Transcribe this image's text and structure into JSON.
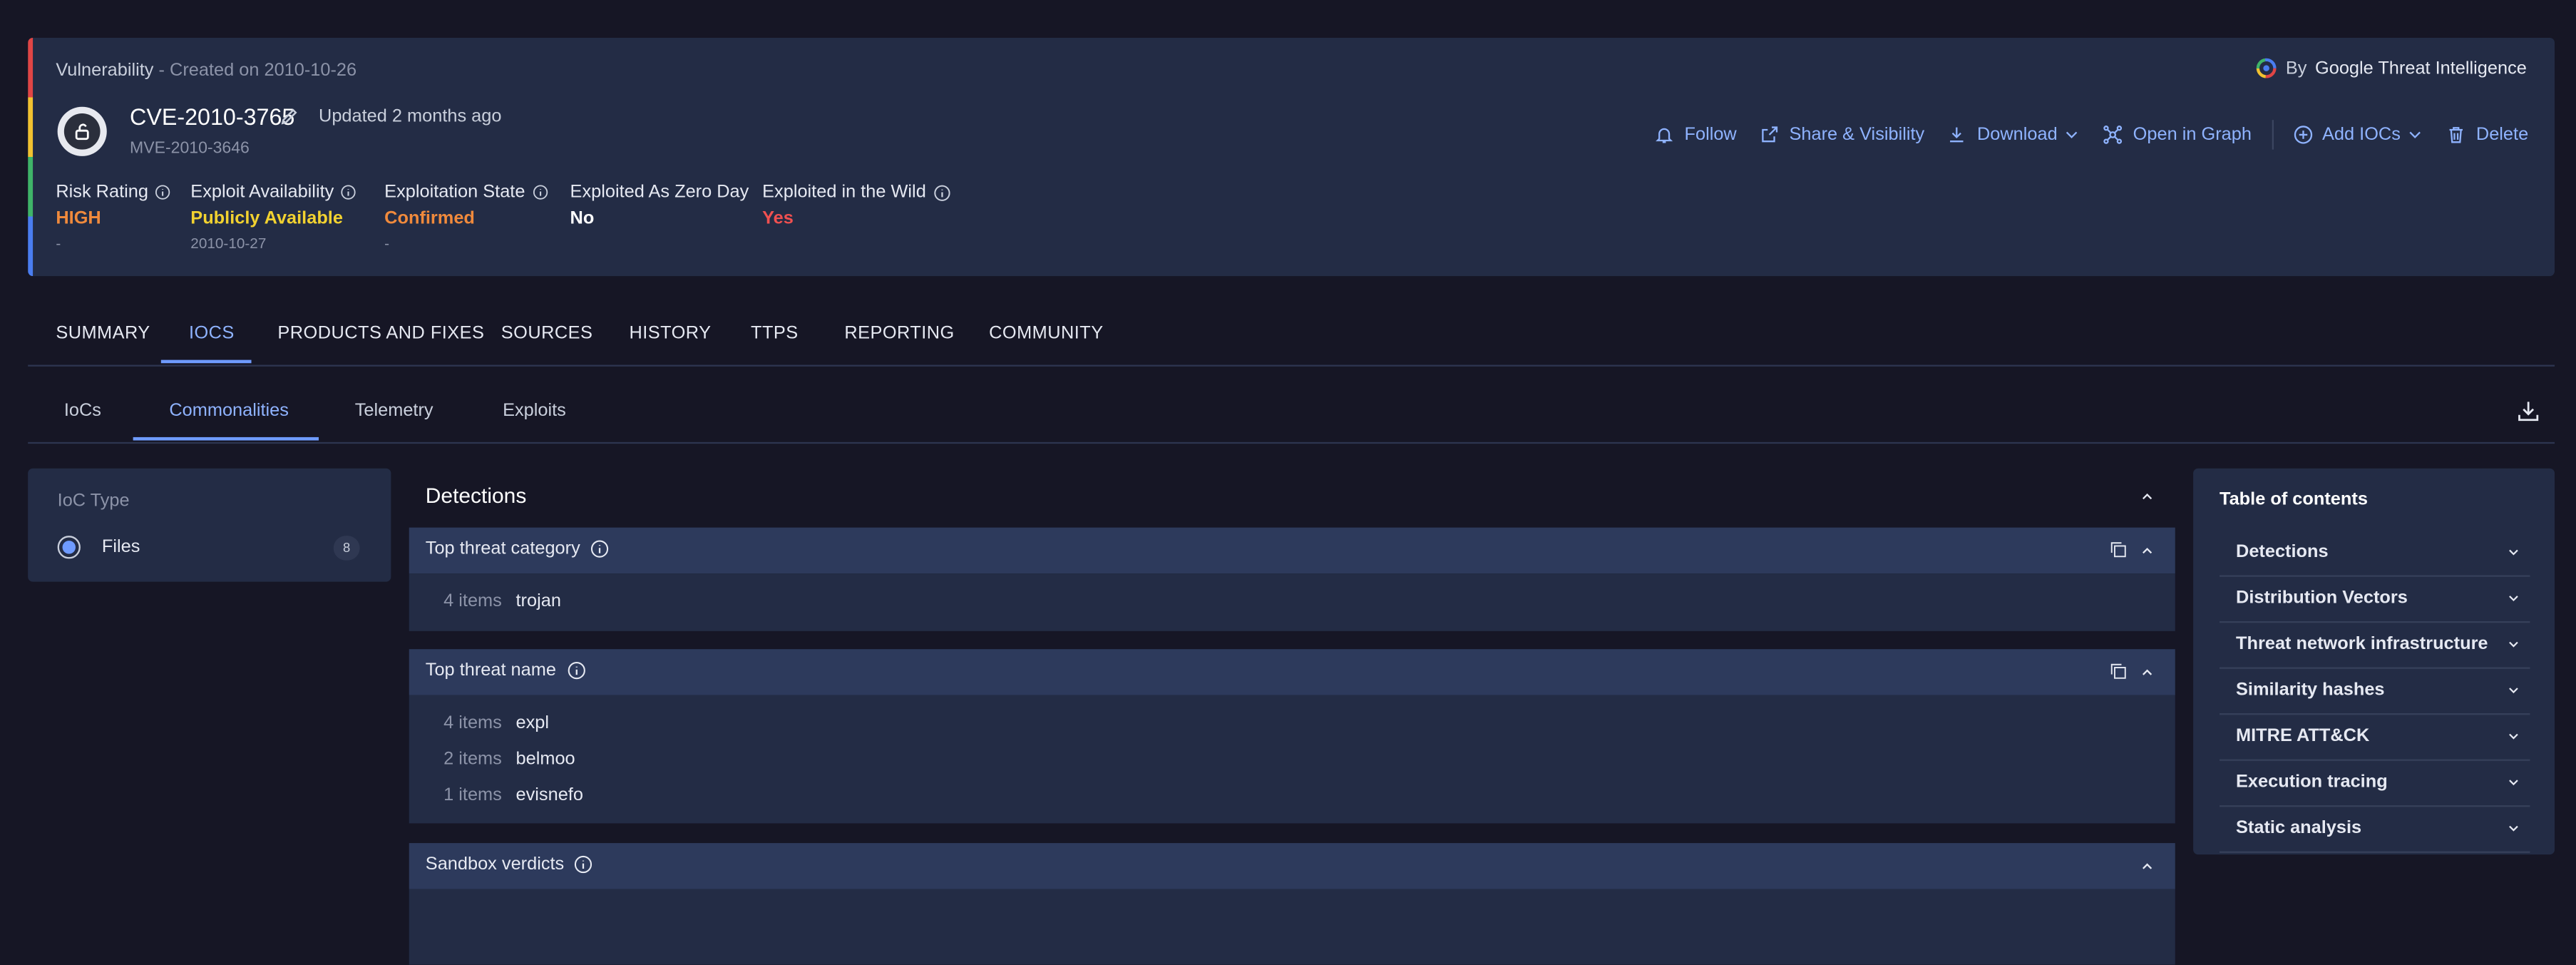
{
  "header": {
    "type_label": "Vulnerability",
    "created": "- Created on 2010-10-26",
    "by_prefix": "By",
    "by_name": "Google Threat Intelligence",
    "cve_id": "CVE-2010-3765",
    "updated": "Updated 2 months ago",
    "mve_id": "MVE-2010-3646",
    "accent_colors": [
      "#e04545",
      "#f2c230",
      "#3fb468",
      "#4a7df0"
    ]
  },
  "actions": {
    "follow": "Follow",
    "share": "Share & Visibility",
    "download": "Download",
    "open_graph": "Open in Graph",
    "add_iocs": "Add IOCs",
    "delete": "Delete"
  },
  "stats": [
    {
      "label": "Risk Rating",
      "value": "HIGH",
      "sub": "-",
      "color": "#f08a3c"
    },
    {
      "label": "Exploit Availability",
      "value": "Publicly Available",
      "sub": "2010-10-27",
      "color": "#f2d230"
    },
    {
      "label": "Exploitation State",
      "value": "Confirmed",
      "sub": "-",
      "color": "#f08a3c"
    },
    {
      "label": "Exploited As Zero Day",
      "value": "No",
      "sub": "",
      "color": "#ffffff"
    },
    {
      "label": "Exploited in the Wild",
      "value": "Yes",
      "sub": "",
      "color": "#f05050"
    }
  ],
  "main_tabs": [
    "SUMMARY",
    "IOCS",
    "PRODUCTS AND FIXES",
    "SOURCES",
    "HISTORY",
    "TTPS",
    "REPORTING",
    "COMMUNITY"
  ],
  "main_tab_active": "IOCS",
  "sub_tabs": [
    "IoCs",
    "Commonalities",
    "Telemetry",
    "Exploits"
  ],
  "sub_tab_active": "Commonalities",
  "ioc_panel": {
    "label": "IoC Type",
    "option": "Files",
    "count": "8"
  },
  "detections": {
    "title": "Detections",
    "sections": [
      {
        "title": "Top threat category",
        "rows": [
          {
            "count": "4 items",
            "name": "trojan"
          }
        ]
      },
      {
        "title": "Top threat name",
        "rows": [
          {
            "count": "4 items",
            "name": "expl"
          },
          {
            "count": "2 items",
            "name": "belmoo"
          },
          {
            "count": "1 items",
            "name": "evisnefo"
          }
        ]
      },
      {
        "title": "Sandbox verdicts",
        "rows": []
      }
    ]
  },
  "toc": {
    "title": "Table of contents",
    "items": [
      "Detections",
      "Distribution Vectors",
      "Threat network infrastructure",
      "Similarity hashes",
      "MITRE ATT&CK",
      "Execution tracing",
      "Static analysis"
    ]
  }
}
